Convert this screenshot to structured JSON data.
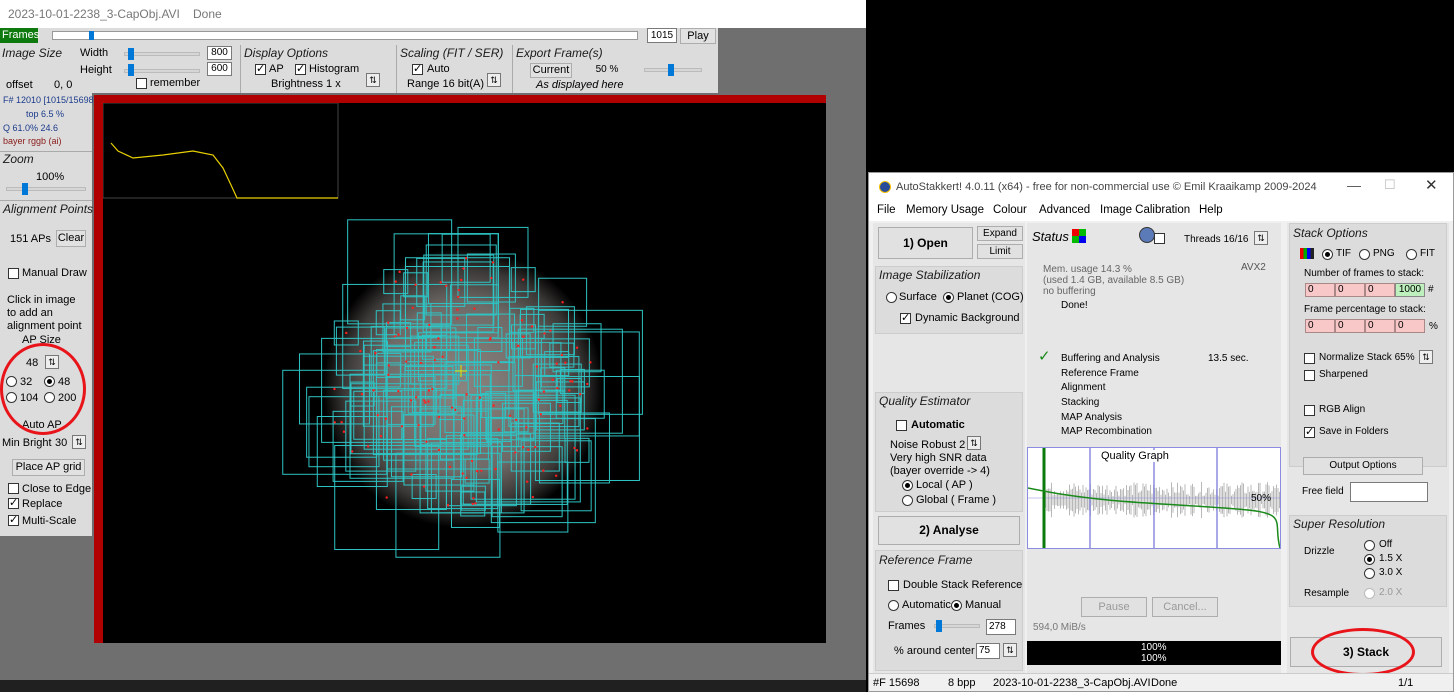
{
  "left_window": {
    "title": "2023-10-01-2238_3-CapObj.AVI",
    "title_status": "Done",
    "frames_label": "Frames",
    "frame_value": "1015",
    "play_label": "Play",
    "image_size": {
      "header": "Image Size",
      "width_label": "Width",
      "width_value": "800",
      "height_label": "Height",
      "height_value": "600",
      "remember_label": "remember",
      "offset_label": "offset",
      "offset_value": "0, 0"
    },
    "display_options": {
      "header": "Display Options",
      "ap_label": "AP",
      "histogram_label": "Histogram",
      "brightness_label": "Brightness 1 x"
    },
    "scaling": {
      "header": "Scaling (FIT / SER)",
      "auto_label": "Auto",
      "range_label": "Range 16 bit(A)"
    },
    "export": {
      "header": "Export Frame(s)",
      "current_label": "Current",
      "percent_value": "50 %",
      "note": "As displayed here"
    },
    "info": {
      "frame": "F# 12010 [1015/15698]",
      "top": "top 6.5 %",
      "q": "Q 61.0%  24.6",
      "bayer": "bayer rggb (ai)"
    },
    "zoom": {
      "header": "Zoom",
      "value": "100%"
    },
    "alignment": {
      "header": "Alignment Points",
      "count": "151 APs",
      "clear_label": "Clear",
      "manual_draw_label": "Manual Draw",
      "click_hint_1": "Click in image",
      "click_hint_2": "to add an",
      "click_hint_3": "alignment point",
      "ap_size_label": "AP Size",
      "ap_size_value": "48",
      "sizes": [
        "32",
        "48",
        "104",
        "200"
      ],
      "auto_ap_label": "Auto AP",
      "min_bright_label": "Min Bright",
      "min_bright_value": "30",
      "place_grid_label": "Place AP grid",
      "close_edge_label": "Close to Edge",
      "replace_label": "Replace",
      "multiscale_label": "Multi-Scale"
    }
  },
  "main_window": {
    "title": "AutoStakkert! 4.0.11 (x64) - free for non-commercial use © Emil Kraaikamp 2009-2024",
    "menu": [
      "File",
      "Memory Usage",
      "Colour",
      "Advanced",
      "Image Calibration",
      "Help"
    ],
    "open_label": "1) Open",
    "expand_label": "Expand",
    "limit_label": "Limit",
    "status_header": "Status",
    "threads_label": "Threads 16/16",
    "mem_usage": "Mem. usage 14.3 %",
    "mem_detail": "(used 1.4 GB, available 8.5 GB)",
    "no_buffering": "no buffering",
    "avx": "AVX2",
    "done_text": "Done!",
    "steps": [
      {
        "label": "Buffering and Analysis",
        "time": "13.5 sec."
      },
      {
        "label": "Reference Frame",
        "time": ""
      },
      {
        "label": "Alignment",
        "time": ""
      },
      {
        "label": "Stacking",
        "time": ""
      },
      {
        "label": "MAP Analysis",
        "time": ""
      },
      {
        "label": "MAP Recombination",
        "time": ""
      }
    ],
    "image_stabilization": {
      "header": "Image Stabilization",
      "surface_label": "Surface",
      "planet_label": "Planet (COG)",
      "dynamic_bg_label": "Dynamic Background"
    },
    "quality_estimator": {
      "header": "Quality Estimator",
      "automatic_label": "Automatic",
      "noise_label": "Noise Robust  2",
      "snr_label": "Very high SNR data",
      "bayer_label": "(bayer override -> 4)",
      "local_label": "Local     ( AP )",
      "global_label": "Global    ( Frame )"
    },
    "analyse_label": "2) Analyse",
    "reference_frame": {
      "header": "Reference Frame",
      "double_label": "Double Stack Reference",
      "automatic_label": "Automatic",
      "manual_label": "Manual",
      "frames_label": "Frames",
      "frames_value": "278",
      "around_label": "% around center",
      "around_value": "75"
    },
    "quality_graph": {
      "title": "Quality Graph",
      "percent": "50%"
    },
    "pause_label": "Pause",
    "cancel_label": "Cancel...",
    "speed": "594,0 MiB/s",
    "progress_1": "100%",
    "progress_2": "100%",
    "stack_options": {
      "header": "Stack Options",
      "tif_label": "TIF",
      "png_label": "PNG",
      "fit_label": "FIT",
      "num_frames_label": "Number of frames to stack:",
      "num_frames_values": [
        "0",
        "0",
        "0",
        "1000"
      ],
      "hash": "#",
      "frame_pct_label": "Frame percentage to stack:",
      "frame_pct_values": [
        "0",
        "0",
        "0",
        "0"
      ],
      "pct": "%",
      "normalize_label": "Normalize Stack 65%",
      "sharpened_label": "Sharpened",
      "rgb_align_label": "RGB Align",
      "save_folders_label": "Save in Folders",
      "output_options_label": "Output Options",
      "free_field_label": "Free field"
    },
    "super_resolution": {
      "header": "Super Resolution",
      "drizzle_label": "Drizzle",
      "off_label": "Off",
      "x15_label": "1.5 X",
      "x30_label": "3.0 X",
      "resample_label": "Resample",
      "resample_value": "2.0 X"
    },
    "stack_label": "3) Stack",
    "status_bar": {
      "frame": "#F 15698",
      "bpp": "8 bpp",
      "file": "2023-10-01-2238_3-CapObj.AVI",
      "state": "Done",
      "page": "1/1"
    }
  },
  "colors": {
    "annotation_red": "#e8141a",
    "frames_green": "#0e7a0e",
    "accent_blue": "#0078d7",
    "ap_box_cyan": "#2ec4c4"
  }
}
